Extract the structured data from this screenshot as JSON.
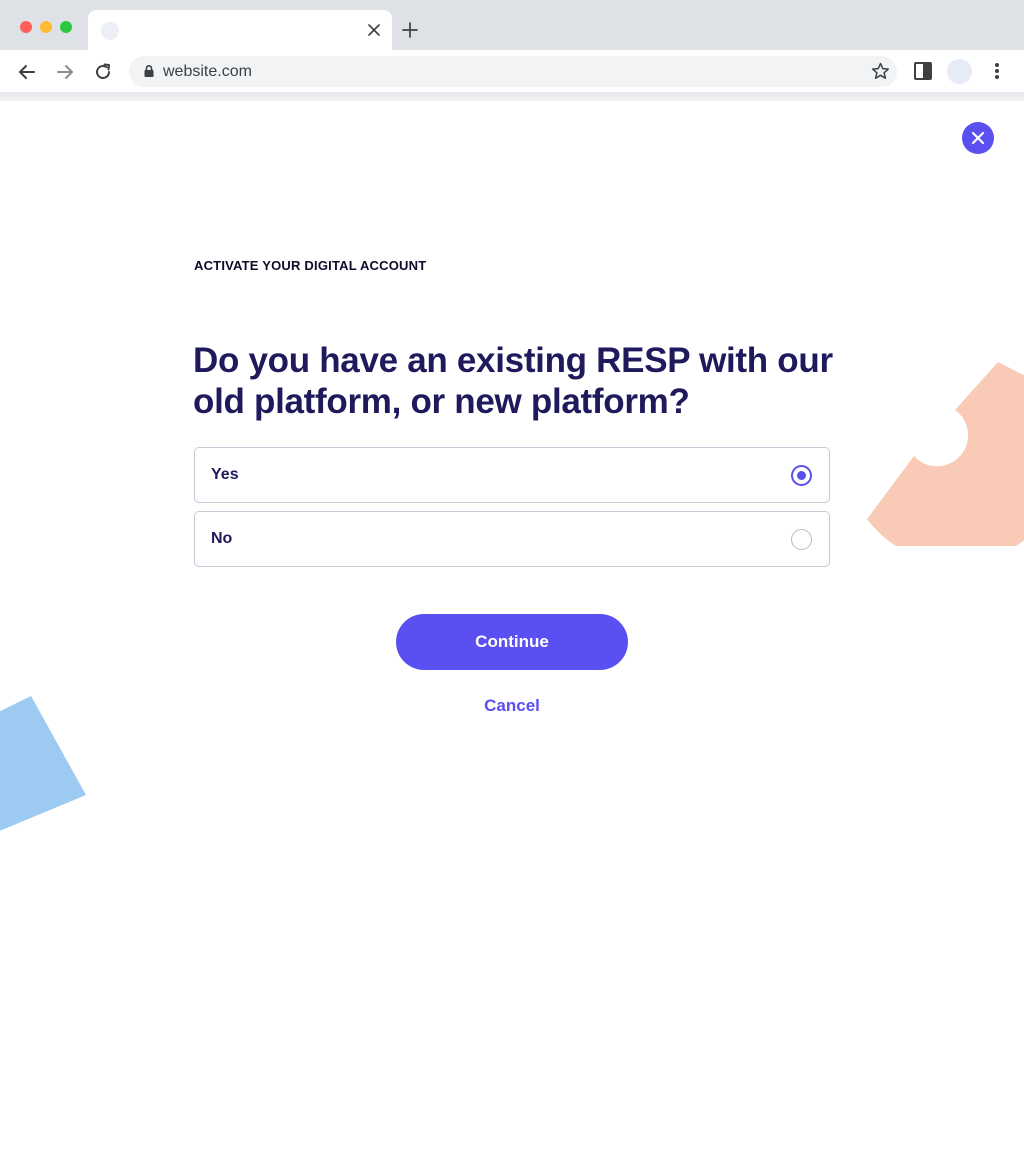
{
  "browser": {
    "url": "website.com",
    "icons": {
      "tab_close": "close-icon",
      "new_tab": "plus-icon",
      "back": "arrow-left-icon",
      "forward": "arrow-right-icon",
      "reload": "reload-icon",
      "lock": "lock-icon",
      "bookmark": "star-icon",
      "reading_mode": "side-panel-icon",
      "menu": "kebab-menu-icon"
    }
  },
  "page": {
    "eyebrow": "ACTIVATE YOUR DIGITAL ACCOUNT",
    "headline": "Do you have an existing RESP with our old platform, or new platform?",
    "options": [
      {
        "label": "Yes",
        "selected": true
      },
      {
        "label": "No",
        "selected": false
      }
    ],
    "continue_label": "Continue",
    "cancel_label": "Cancel",
    "close_icon": "close-icon"
  },
  "colors": {
    "accent": "#5a4ff0",
    "heading": "#1f1a5c",
    "deco_peach": "#f9cbb6",
    "deco_blue": "#9ccaf1"
  }
}
